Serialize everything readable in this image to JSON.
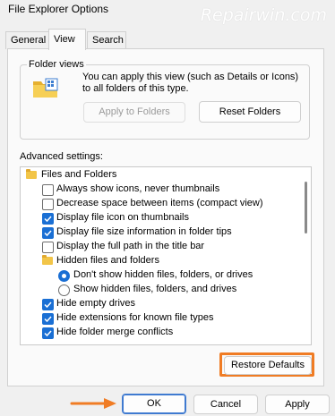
{
  "window": {
    "title": "File Explorer Options",
    "watermark": "Repairwin.com"
  },
  "tabs": [
    {
      "label": "General",
      "active": false
    },
    {
      "label": "View",
      "active": true
    },
    {
      "label": "Search",
      "active": false
    }
  ],
  "folder_views": {
    "heading": "Folder views",
    "description": "You can apply this view (such as Details or Icons) to all folders of this type.",
    "apply_label": "Apply to Folders",
    "reset_label": "Reset Folders"
  },
  "advanced": {
    "heading": "Advanced settings:",
    "items": [
      {
        "label": "Files and Folders",
        "kind": "folder"
      },
      {
        "label": "Always show icons, never thumbnails",
        "kind": "check",
        "checked": false
      },
      {
        "label": "Decrease space between items (compact view)",
        "kind": "check",
        "checked": false
      },
      {
        "label": "Display file icon on thumbnails",
        "kind": "check",
        "checked": true
      },
      {
        "label": "Display file size information in folder tips",
        "kind": "check",
        "checked": true
      },
      {
        "label": "Display the full path in the title bar",
        "kind": "check",
        "checked": false
      },
      {
        "label": "Hidden files and folders",
        "kind": "folder"
      },
      {
        "label": "Don't show hidden files, folders, or drives",
        "kind": "radio",
        "checked": true
      },
      {
        "label": "Show hidden files, folders, and drives",
        "kind": "radio",
        "checked": false
      },
      {
        "label": "Hide empty drives",
        "kind": "check",
        "checked": true
      },
      {
        "label": "Hide extensions for known file types",
        "kind": "check",
        "checked": true
      },
      {
        "label": "Hide folder merge conflicts",
        "kind": "check",
        "checked": true
      }
    ],
    "restore_label": "Restore Defaults"
  },
  "footer": {
    "ok_label": "OK",
    "cancel_label": "Cancel",
    "apply_label": "Apply"
  },
  "colors": {
    "accent": "#1a6fd4",
    "highlight": "#f07c24"
  }
}
